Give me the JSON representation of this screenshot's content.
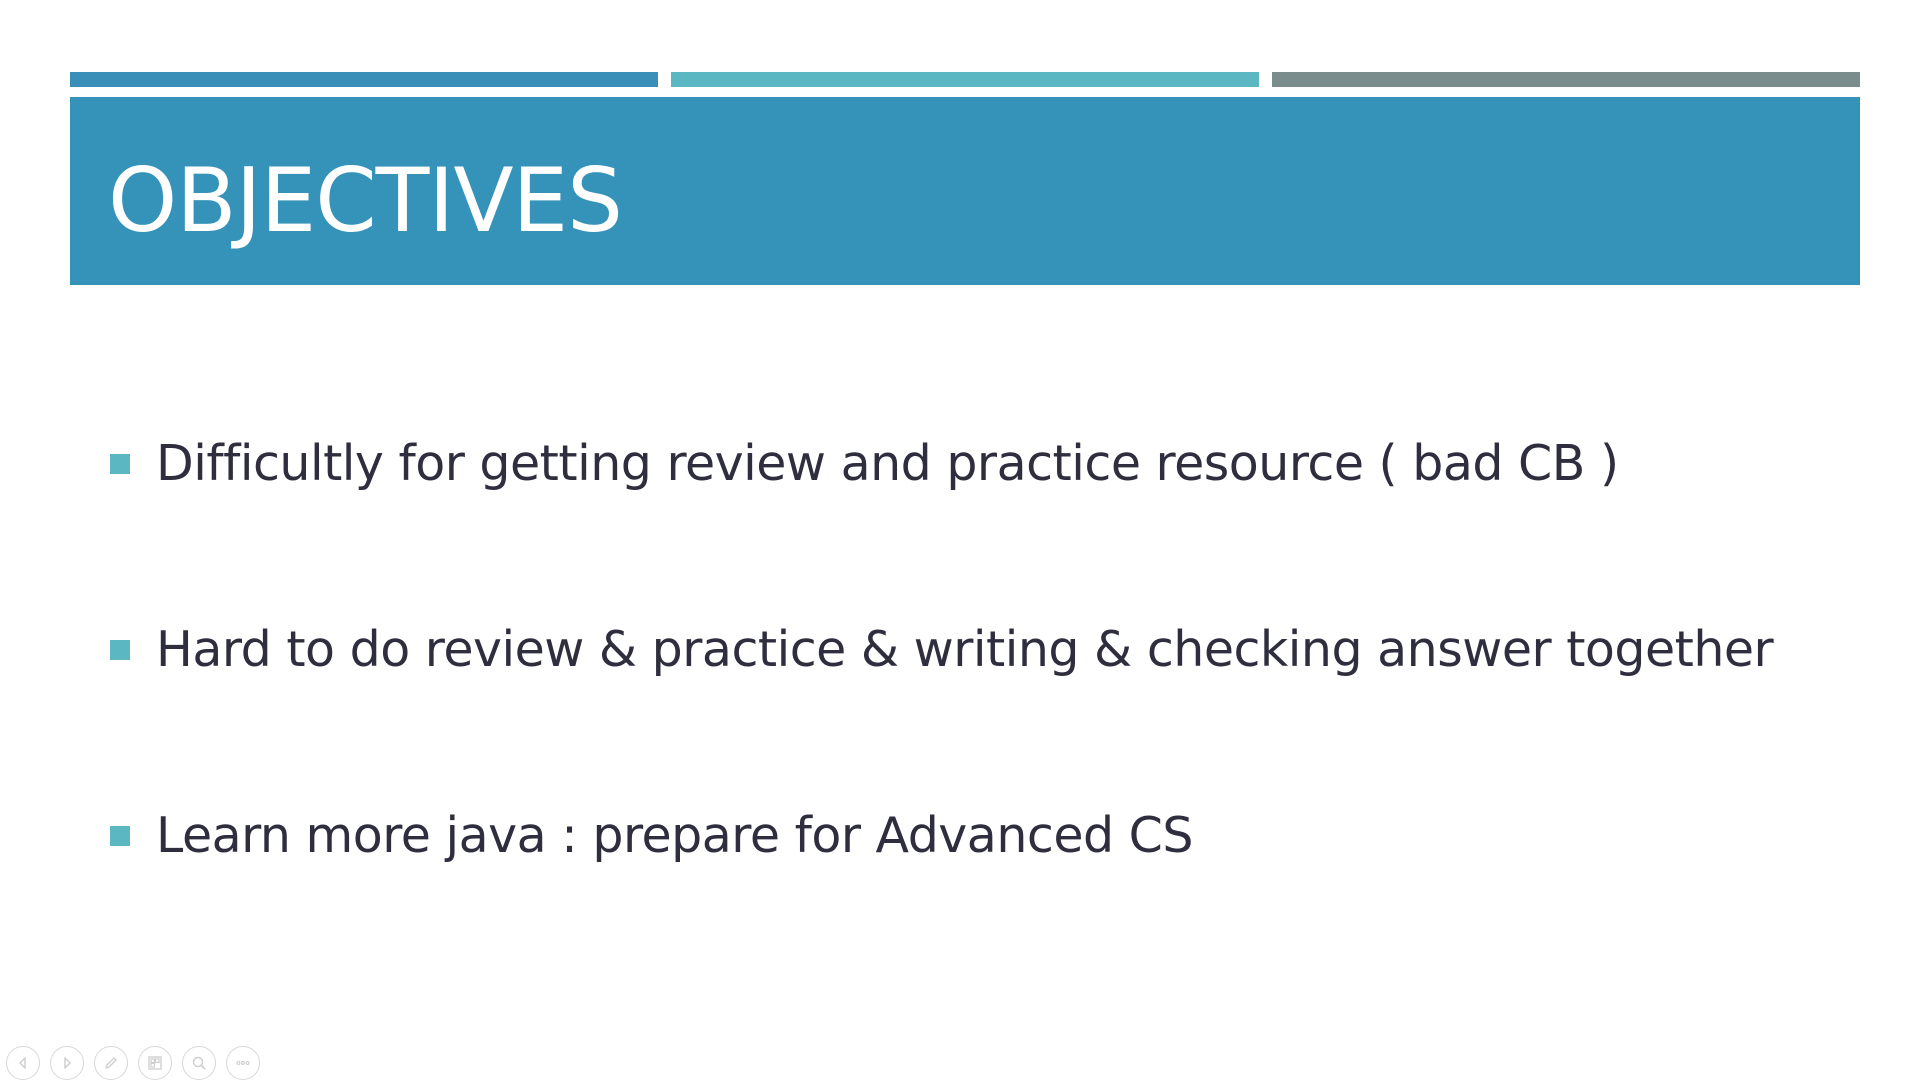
{
  "slide": {
    "title": "OBJECTIVES",
    "bullets": [
      "Difficultly for getting review and practice resource ( bad CB )",
      "Hard to do review & practice & writing & checking answer together",
      "Learn more java : prepare for Advanced CS"
    ]
  },
  "colors": {
    "title_band": "#3593BA",
    "bar_blue": "#3A8FB9",
    "bar_teal": "#5BB7C2",
    "bar_gray": "#7B8C8C",
    "bullet_marker": "#5BB7C2",
    "body_text": "#2E2E3E"
  },
  "controls": {
    "icons": [
      "previous-slide-icon",
      "next-slide-icon",
      "pen-icon",
      "slide-grid-icon",
      "zoom-icon",
      "more-options-icon"
    ]
  }
}
